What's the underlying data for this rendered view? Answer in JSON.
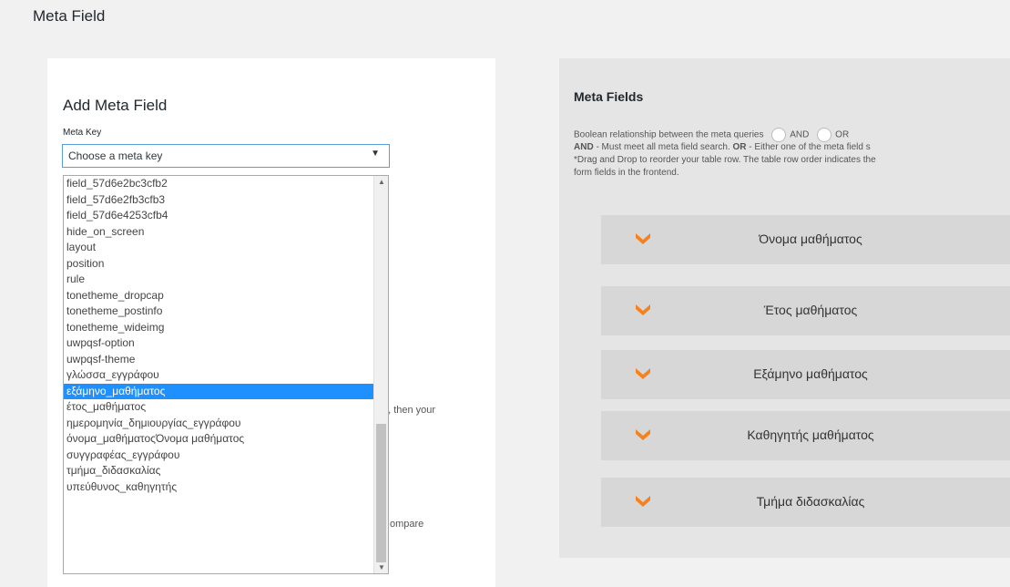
{
  "page": {
    "title": "Meta Field"
  },
  "add_panel": {
    "title": "Add Meta Field",
    "meta_key_label": "Meta Key",
    "select_value": "Choose a meta key",
    "hidden_text_1": "', then your",
    "hidden_text_2": "ompare"
  },
  "dropdown": {
    "items": [
      "field_57d6e2bc3cfb2",
      "field_57d6e2fb3cfb3",
      "field_57d6e4253cfb4",
      "hide_on_screen",
      "layout",
      "position",
      "rule",
      "tonetheme_dropcap",
      "tonetheme_postinfo",
      "tonetheme_wideimg",
      "uwpqsf-option",
      "uwpqsf-theme",
      "γλώσσα_εγγράφου",
      "εξάμηνο_μαθήματος",
      "έτος_μαθήματος",
      "ημερομηνία_δημιουργίας_εγγράφου",
      "όνομα_μαθήματοςΌνομα μαθήματος",
      "συγγραφέας_εγγράφου",
      "τμήμα_διδασκαλίας",
      "υπεύθυνος_καθηγητής"
    ],
    "selected": "εξάμηνο_μαθήματος"
  },
  "meta_fields_panel": {
    "title": "Meta Fields",
    "relationship_text": "Boolean relationship between the meta queries",
    "and_label": "AND",
    "or_label": "OR",
    "and_bold": "AND",
    "and_desc": " - Must meet all meta field search. ",
    "or_bold": "OR",
    "or_desc": " - Either one of the meta field s",
    "drag_line1": "*Drag and Drop to reorder your table row. The table row order indicates the",
    "drag_line2": "form fields in the frontend.",
    "fields": [
      "Όνομα μαθήματος",
      "Έτος μαθήματος",
      "Εξάμηνο μαθήματος",
      "Καθηγητής μαθήματος",
      "Τμήμα διδασκαλίας"
    ]
  },
  "colors": {
    "accent_orange": "#f5821f",
    "selection_blue": "#1e90ff"
  }
}
